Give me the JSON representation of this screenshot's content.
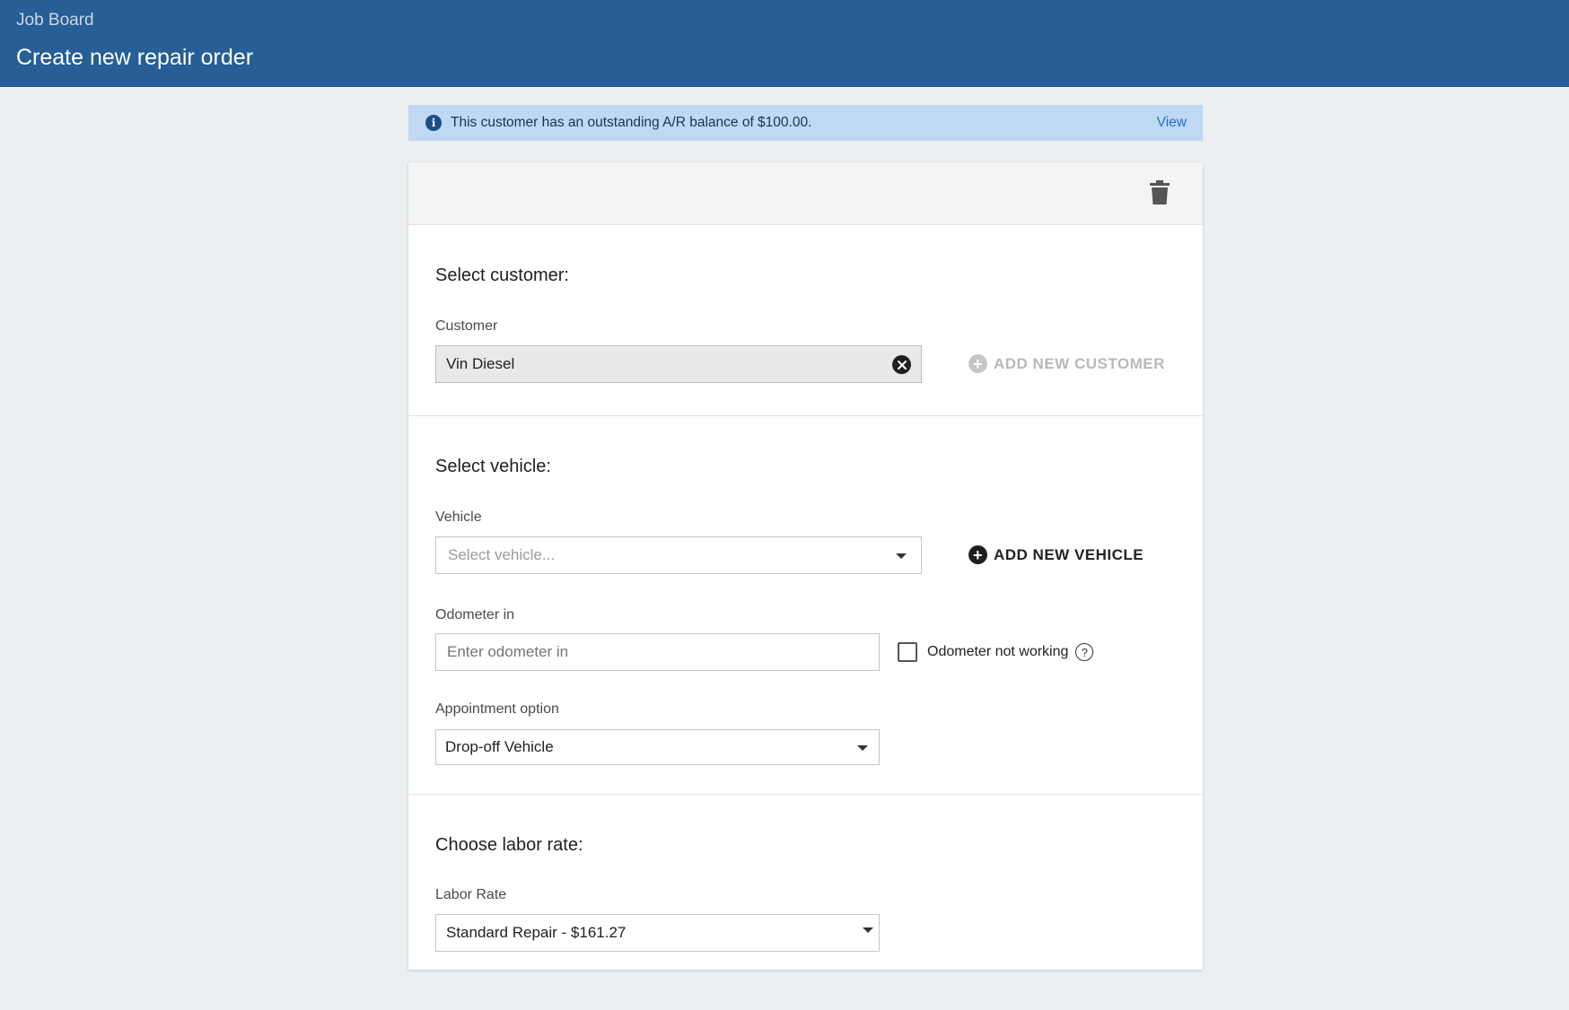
{
  "header": {
    "breadcrumb": "Job Board",
    "title": "Create new repair order"
  },
  "banner": {
    "message": "This customer has an outstanding A/R balance of $100.00.",
    "link": "View"
  },
  "customer_section": {
    "title": "Select customer:",
    "field_label": "Customer",
    "value": "Vin Diesel",
    "add_button": "ADD NEW CUSTOMER"
  },
  "vehicle_section": {
    "title": "Select vehicle:",
    "vehicle_label": "Vehicle",
    "vehicle_placeholder": "Select vehicle...",
    "add_button": "ADD NEW VEHICLE",
    "odometer_label": "Odometer in",
    "odometer_placeholder": "Enter odometer in",
    "odometer_checkbox": "Odometer not working",
    "appointment_label": "Appointment option",
    "appointment_value": "Drop-off Vehicle"
  },
  "labor_section": {
    "title": "Choose labor rate:",
    "field_label": "Labor Rate",
    "value": "Standard Repair - $161.27"
  },
  "colors": {
    "header_bg": "#265e95",
    "banner_bg": "#bfd8f4",
    "link": "#2a6fc0"
  }
}
